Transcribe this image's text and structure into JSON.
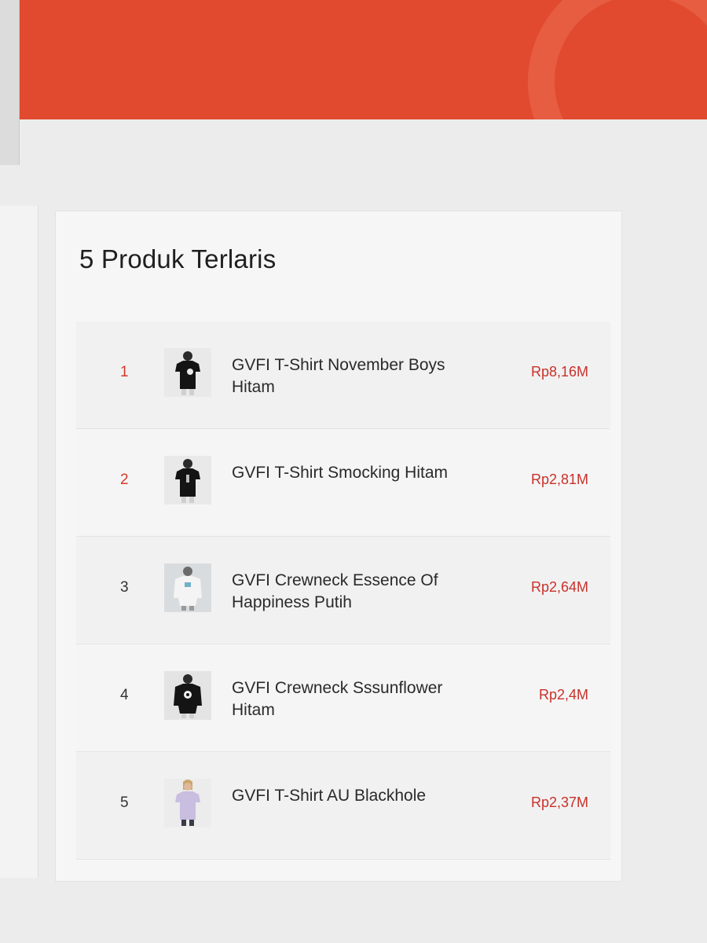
{
  "section": {
    "title": "5 Produk Terlaris"
  },
  "products": [
    {
      "rank": "1",
      "name": "GVFI T-Shirt November Boys Hitam",
      "price": "Rp8,16M",
      "image": "black-tshirt-back"
    },
    {
      "rank": "2",
      "name": "GVFI T-Shirt Smocking Hitam",
      "price": "Rp2,81M",
      "image": "black-tshirt-back"
    },
    {
      "rank": "3",
      "name": "GVFI Crewneck Essence Of Happiness Putih",
      "price": "Rp2,64M",
      "image": "white-crewneck-back"
    },
    {
      "rank": "4",
      "name": "GVFI Crewneck Sssunflower Hitam",
      "price": "Rp2,4M",
      "image": "black-crewneck-back"
    },
    {
      "rank": "5",
      "name": "GVFI T-Shirt AU Blackhole",
      "price": "Rp2,37M",
      "image": "lavender-tshirt-front"
    }
  ],
  "colors": {
    "banner": "#e14a2f",
    "price": "#c9312a",
    "rank_highlight": "#d33a2c"
  }
}
